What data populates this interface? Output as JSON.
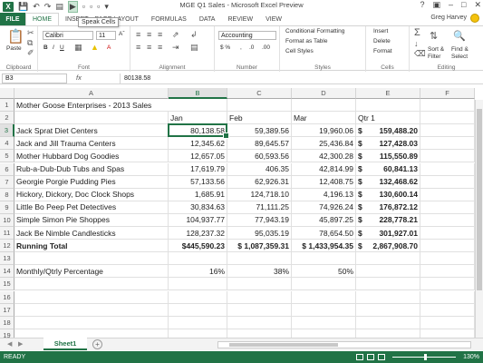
{
  "window": {
    "title": "MGE Q1 Sales - Microsoft Excel Preview",
    "tooltip": "Speak Cells"
  },
  "tabs": [
    "FILE",
    "HOME",
    "INSERT",
    "PAGE LAYOUT",
    "FORMULAS",
    "DATA",
    "REVIEW",
    "VIEW"
  ],
  "active_tab": "HOME",
  "user": "Greg Harvey",
  "ribbon": {
    "clipboard": {
      "paste": "Paste",
      "label": "Clipboard"
    },
    "font": {
      "name": "Calibri",
      "size": "11",
      "label": "Font"
    },
    "alignment": {
      "label": "Alignment"
    },
    "number": {
      "format": "Accounting",
      "label": "Number"
    },
    "styles": {
      "conditional": "Conditional Formatting",
      "format_table": "Format as Table",
      "cell_styles": "Cell Styles",
      "label": "Styles"
    },
    "cells": {
      "insert": "Insert",
      "delete": "Delete",
      "format": "Format",
      "label": "Cells"
    },
    "editing": {
      "sort": "Sort &",
      "filter": "Filter",
      "find": "Find &",
      "select": "Select",
      "label": "Editing"
    }
  },
  "formula_bar": {
    "name_box": "B3",
    "fx": "fx",
    "content": "80138.58"
  },
  "columns": [
    "A",
    "B",
    "C",
    "D",
    "E",
    "F"
  ],
  "selected_column": "B",
  "selected_row": "3",
  "rows": [
    {
      "n": "1",
      "A": "Mother Goose Enterprises - 2013 Sales",
      "B": "",
      "C": "",
      "D": "",
      "E": ""
    },
    {
      "n": "2",
      "A": "",
      "B": "Jan",
      "C": "Feb",
      "D": "Mar",
      "E": "Qtr 1"
    },
    {
      "n": "3",
      "A": "Jack Sprat Diet Centers",
      "B": "80,138.58",
      "C": "59,389.56",
      "D": "19,960.06",
      "Ecur": "$",
      "E": "159,488.20"
    },
    {
      "n": "4",
      "A": "Jack and Jill Trauma Centers",
      "B": "12,345.62",
      "C": "89,645.57",
      "D": "25,436.84",
      "Ecur": "$",
      "E": "127,428.03"
    },
    {
      "n": "5",
      "A": "Mother Hubbard Dog Goodies",
      "B": "12,657.05",
      "C": "60,593.56",
      "D": "42,300.28",
      "Ecur": "$",
      "E": "115,550.89"
    },
    {
      "n": "6",
      "A": "Rub-a-Dub-Dub Tubs and Spas",
      "B": "17,619.79",
      "C": "406.35",
      "D": "42,814.99",
      "Ecur": "$",
      "E": "60,841.13"
    },
    {
      "n": "7",
      "A": "Georgie Porgie Pudding Pies",
      "B": "57,133.56",
      "C": "62,926.31",
      "D": "12,408.75",
      "Ecur": "$",
      "E": "132,468.62"
    },
    {
      "n": "8",
      "A": "Hickory, Dickory, Doc Clock Shops",
      "B": "1,685.91",
      "C": "124,718.10",
      "D": "4,196.13",
      "Ecur": "$",
      "E": "130,600.14"
    },
    {
      "n": "9",
      "A": "Little Bo Peep Pet Detectives",
      "B": "30,834.63",
      "C": "71,111.25",
      "D": "74,926.24",
      "Ecur": "$",
      "E": "176,872.12"
    },
    {
      "n": "10",
      "A": "Simple Simon Pie Shoppes",
      "B": "104,937.77",
      "C": "77,943.19",
      "D": "45,897.25",
      "Ecur": "$",
      "E": "228,778.21"
    },
    {
      "n": "11",
      "A": "Jack Be Nimble Candlesticks",
      "B": "128,237.32",
      "C": "95,035.19",
      "D": "78,654.50",
      "Ecur": "$",
      "E": "301,927.01"
    },
    {
      "n": "12",
      "A": "Running Total",
      "B": "$445,590.23",
      "C": "$ 1,087,359.31",
      "D": "$ 1,433,954.35",
      "Ecur": "$",
      "E": "2,867,908.70"
    },
    {
      "n": "13",
      "A": "",
      "B": "",
      "C": "",
      "D": "",
      "E": ""
    },
    {
      "n": "14",
      "A": "Monthly/Qtrly Percentage",
      "B": "16%",
      "C": "38%",
      "D": "50%",
      "E": ""
    },
    {
      "n": "15",
      "A": "",
      "B": "",
      "C": "",
      "D": "",
      "E": ""
    },
    {
      "n": "16",
      "A": "",
      "B": "",
      "C": "",
      "D": "",
      "E": ""
    },
    {
      "n": "17",
      "A": "",
      "B": "",
      "C": "",
      "D": "",
      "E": ""
    },
    {
      "n": "18",
      "A": "",
      "B": "",
      "C": "",
      "D": "",
      "E": ""
    },
    {
      "n": "19",
      "A": "",
      "B": "",
      "C": "",
      "D": "",
      "E": ""
    }
  ],
  "sheet_tabs": [
    "Sheet1"
  ],
  "status": {
    "ready": "READY",
    "zoom": "130%"
  },
  "accent_color": "#217346"
}
